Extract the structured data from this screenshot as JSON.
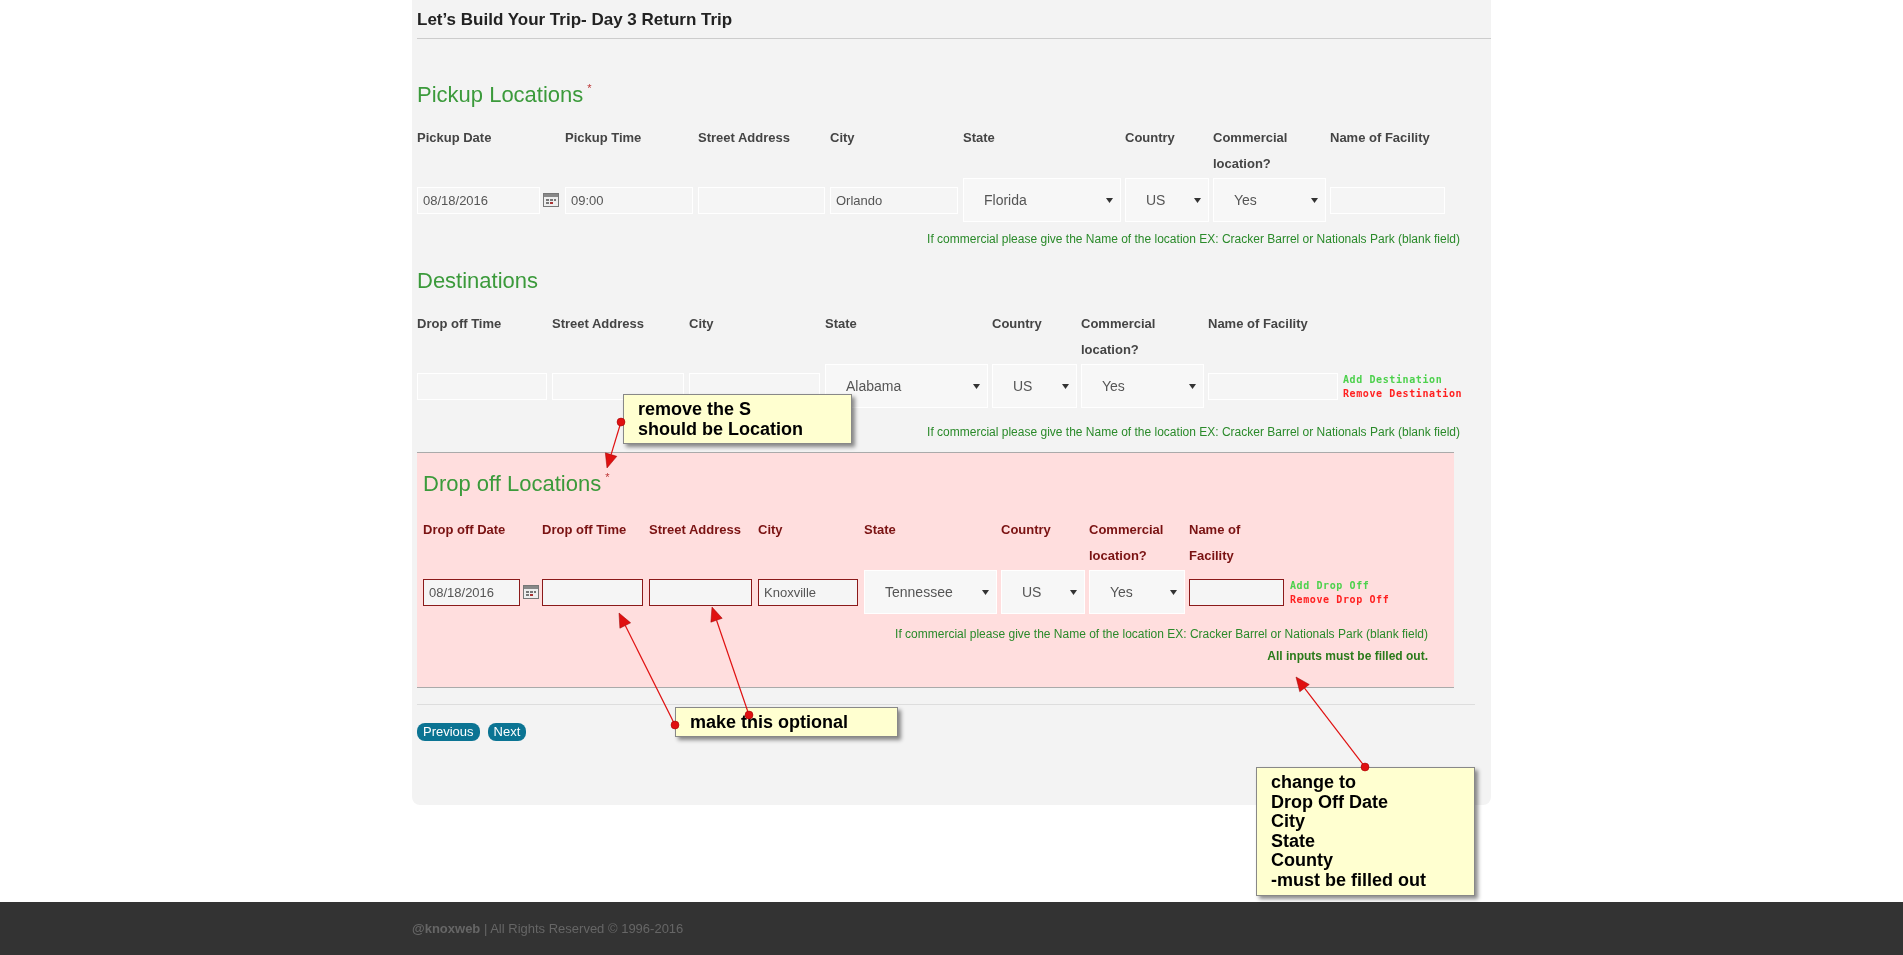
{
  "page_title": "Let’s Build Your Trip- Day 3 Return Trip",
  "pickup": {
    "heading": "Pickup Locations",
    "required_mark": "*",
    "fields": [
      {
        "label": "Pickup Date",
        "kind": "date",
        "value": "08/18/2016"
      },
      {
        "label": "Pickup Time",
        "kind": "text",
        "value": "09:00"
      },
      {
        "label": "Street Address",
        "kind": "text"
      },
      {
        "label": "City",
        "kind": "text",
        "value": "Orlando"
      },
      {
        "label": "State",
        "kind": "select",
        "value": "Florida"
      },
      {
        "label": "Country",
        "kind": "select",
        "value": "US"
      },
      {
        "label": "Commercial location?",
        "kind": "select",
        "value": "Yes"
      },
      {
        "label": "Name of Facility",
        "kind": "text"
      }
    ],
    "note": "If commercial please give the Name of the location EX: Cracker Barrel or Nationals Park (blank field)"
  },
  "destinations": {
    "heading": "Destinations",
    "fields": [
      {
        "label": "Drop off Time",
        "kind": "text"
      },
      {
        "label": "Street Address",
        "kind": "text"
      },
      {
        "label": "City",
        "kind": "text"
      },
      {
        "label": "State",
        "kind": "select",
        "value": "Alabama"
      },
      {
        "label": "Country",
        "kind": "select",
        "value": "US"
      },
      {
        "label": "Commercial location?",
        "kind": "select",
        "value": "Yes"
      },
      {
        "label": "Name of Facility",
        "kind": "text"
      }
    ],
    "add_link": "Add Destination",
    "remove_link": "Remove Destination",
    "note": "If commercial please give the Name of the location EX: Cracker Barrel or Nationals Park (blank field)"
  },
  "drop_off": {
    "heading": "Drop off Locations",
    "required_mark": "*",
    "fields": [
      {
        "label": "Drop off Date",
        "kind": "date",
        "value": "08/18/2016"
      },
      {
        "label": "Drop off Time",
        "kind": "text"
      },
      {
        "label": "Street Address",
        "kind": "text"
      },
      {
        "label": "City",
        "kind": "text",
        "value": "Knoxville"
      },
      {
        "label": "State",
        "kind": "select",
        "value": "Tennessee"
      },
      {
        "label": "Country",
        "kind": "select",
        "value": "US"
      },
      {
        "label": "Commercial location?",
        "kind": "select",
        "value": "Yes"
      },
      {
        "label": "Name of Facility",
        "kind": "text"
      }
    ],
    "add_link": "Add Drop Off",
    "remove_link": "Remove Drop Off",
    "note": "If commercial please give the Name of the location EX: Cracker Barrel or Nationals Park (blank field)",
    "warning": "All inputs must be filled out."
  },
  "buttons": [
    "Previous",
    "Next"
  ],
  "footer": "**@knoxweb** | All Rights Reserved © 1996-2016",
  "annotations": [
    {
      "lines": [
        "remove the S",
        "should be Location"
      ]
    },
    {
      "lines": [
        "make this optional"
      ]
    },
    {
      "lines": [
        "change to",
        "Drop Off Date",
        "City",
        "State",
        "County",
        "-must be filled out"
      ]
    }
  ]
}
